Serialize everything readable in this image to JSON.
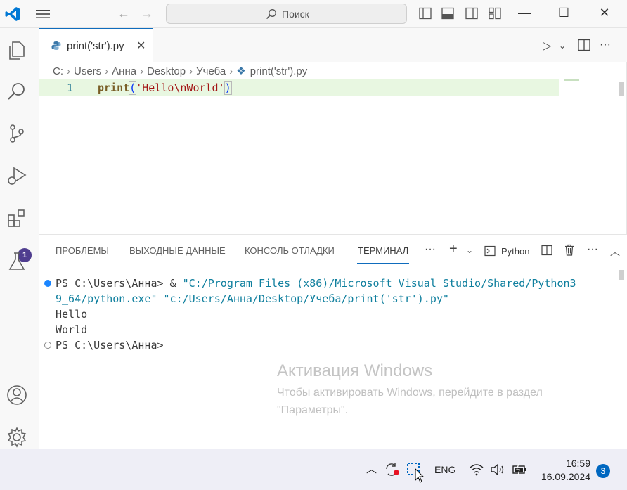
{
  "titlebar": {
    "search_placeholder": "Поиск",
    "back_icon": "arrow-left-icon",
    "forward_icon": "arrow-right-icon"
  },
  "activity": {
    "extensions_badge": "1"
  },
  "editor": {
    "tab_label": "print('str').py",
    "breadcrumb": [
      "C:",
      "Users",
      "Анна",
      "Desktop",
      "Учеба",
      "print('str').py"
    ],
    "line_number": "1",
    "code": {
      "fn": "print",
      "open": "(",
      "string": "'Hello\\nWorld'",
      "close": ")"
    }
  },
  "panel": {
    "tabs": [
      "ПРОБЛЕМЫ",
      "ВЫХОДНЫЕ ДАННЫЕ",
      "КОНСОЛЬ ОТЛАДКИ",
      "ТЕРМИНАЛ"
    ],
    "more_label": "···",
    "terminal_name": "Python",
    "terminal": {
      "prompt1": "PS C:\\Users\\Анна> & ",
      "cmd1": "\"C:/Program Files (x86)/Microsoft Visual Studio/Shared/Python3",
      "cmd2": "9_64/python.exe\" \"c:/Users/Анна/Desktop/Учеба/print('str').py\"",
      "out1": "Hello",
      "out2": "World",
      "prompt2": "PS C:\\Users\\Анна>"
    },
    "watermark": {
      "title": "Активация Windows",
      "subtitle": "Чтобы активировать Windows, перейдите в раздел \"Параметры\"."
    }
  },
  "taskbar": {
    "language": "ENG",
    "time": "16:59",
    "date": "16.09.2024",
    "notifications": "3"
  },
  "colors": {
    "accent": "#0f6cbd",
    "current_line": "#e8f7e1",
    "badge": "#4f3d8f"
  }
}
